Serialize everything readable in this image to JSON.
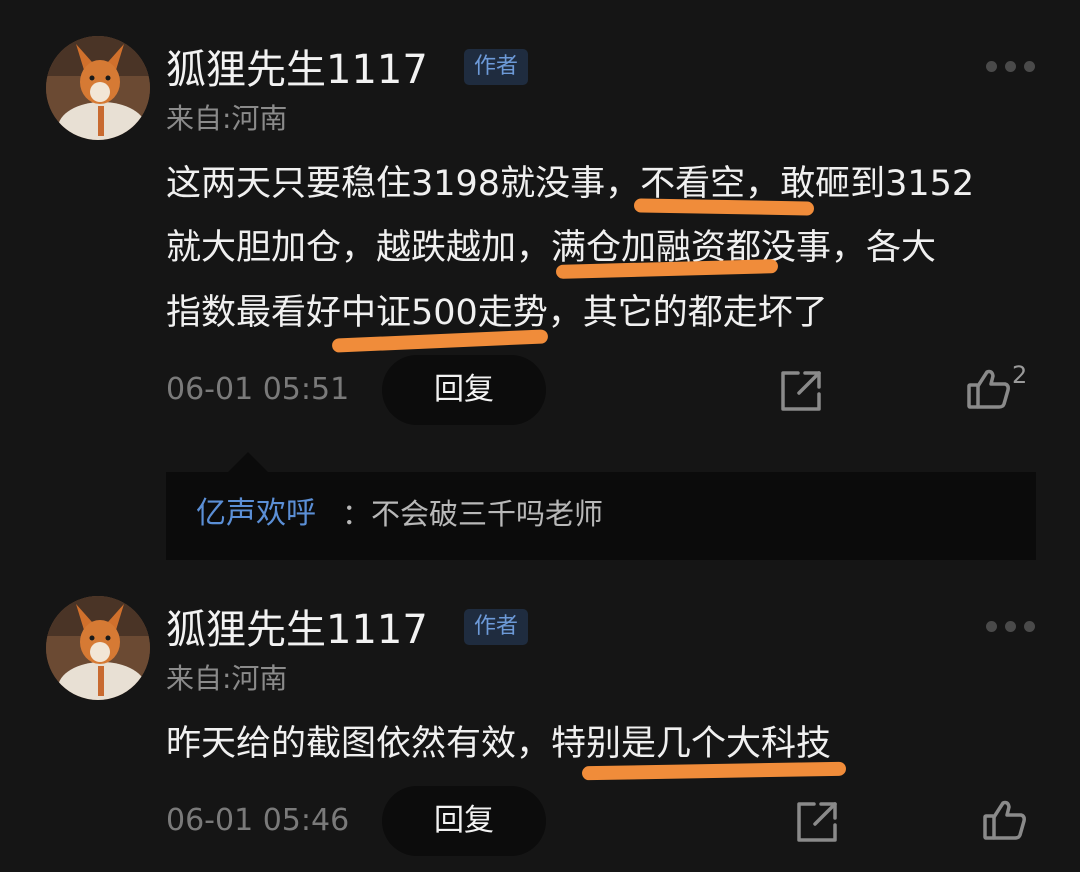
{
  "comments": [
    {
      "username": "狐狸先生1117",
      "badge": "作者",
      "location": "来自:河南",
      "lines": [
        "这两天只要稳住3198就没事，不看空，敢砸到3152",
        "就大胆加仓，越跌越加，满仓加融资都没事，各大",
        "指数最看好中证500走势，其它的都走坏了"
      ],
      "time": "06-01 05:51",
      "reply_label": "回复",
      "like_count": "2",
      "replies": [
        {
          "user": "亿声欢呼",
          "text": "：不会破三千吗老师"
        }
      ]
    },
    {
      "username": "狐狸先生1117",
      "badge": "作者",
      "location": "来自:河南",
      "lines": [
        "昨天给的截图依然有效，特别是几个大科技"
      ],
      "time": "06-01 05:46",
      "reply_label": "回复",
      "like_count": ""
    }
  ],
  "icons": {
    "share": "share-icon",
    "like": "thumbs-up-icon",
    "more": "more-dots-icon"
  },
  "colors": {
    "background": "#151515",
    "highlight_underline": "#f08c3a",
    "badge_text": "#6d9ad8",
    "reply_user": "#5b8fd6"
  }
}
